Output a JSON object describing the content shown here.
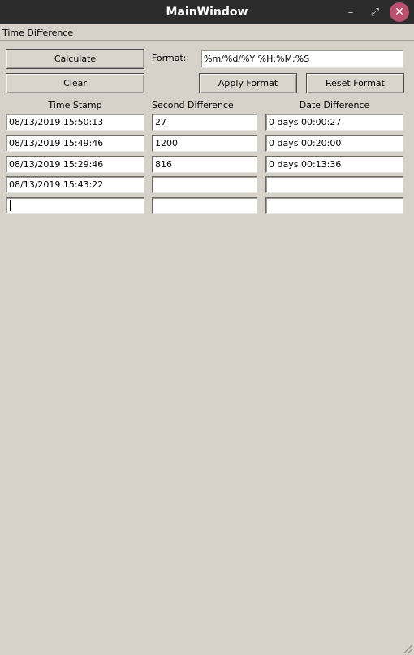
{
  "window": {
    "title": "MainWindow",
    "minimize_glyph": "–",
    "maximize_glyph": "⤢",
    "close_glyph": "✕"
  },
  "menu": {
    "items": [
      "Time Difference"
    ]
  },
  "toolbar": {
    "calculate_label": "Calculate",
    "clear_label": "Clear",
    "format_label": "Format:",
    "format_value": "%m/%d/%Y %H:%M:%S",
    "apply_format_label": "Apply Format",
    "reset_format_label": "Reset Format"
  },
  "columns": {
    "timestamp": "Time Stamp",
    "seconds": "Second Difference",
    "date": "Date Difference"
  },
  "rows": [
    {
      "timestamp": "08/13/2019 15:50:13",
      "seconds": "27",
      "date": "0 days 00:00:27"
    },
    {
      "timestamp": "08/13/2019 15:49:46",
      "seconds": "1200",
      "date": "0 days 00:20:00"
    },
    {
      "timestamp": "08/13/2019 15:29:46",
      "seconds": "816",
      "date": "0 days 00:13:36"
    },
    {
      "timestamp": "08/13/2019 15:43:22",
      "seconds": "",
      "date": ""
    },
    {
      "timestamp": "",
      "seconds": "",
      "date": ""
    }
  ],
  "colors": {
    "titlebar": "#2c2c2c",
    "window_bg": "#d6d2ca",
    "close_button": "#b8506f"
  }
}
